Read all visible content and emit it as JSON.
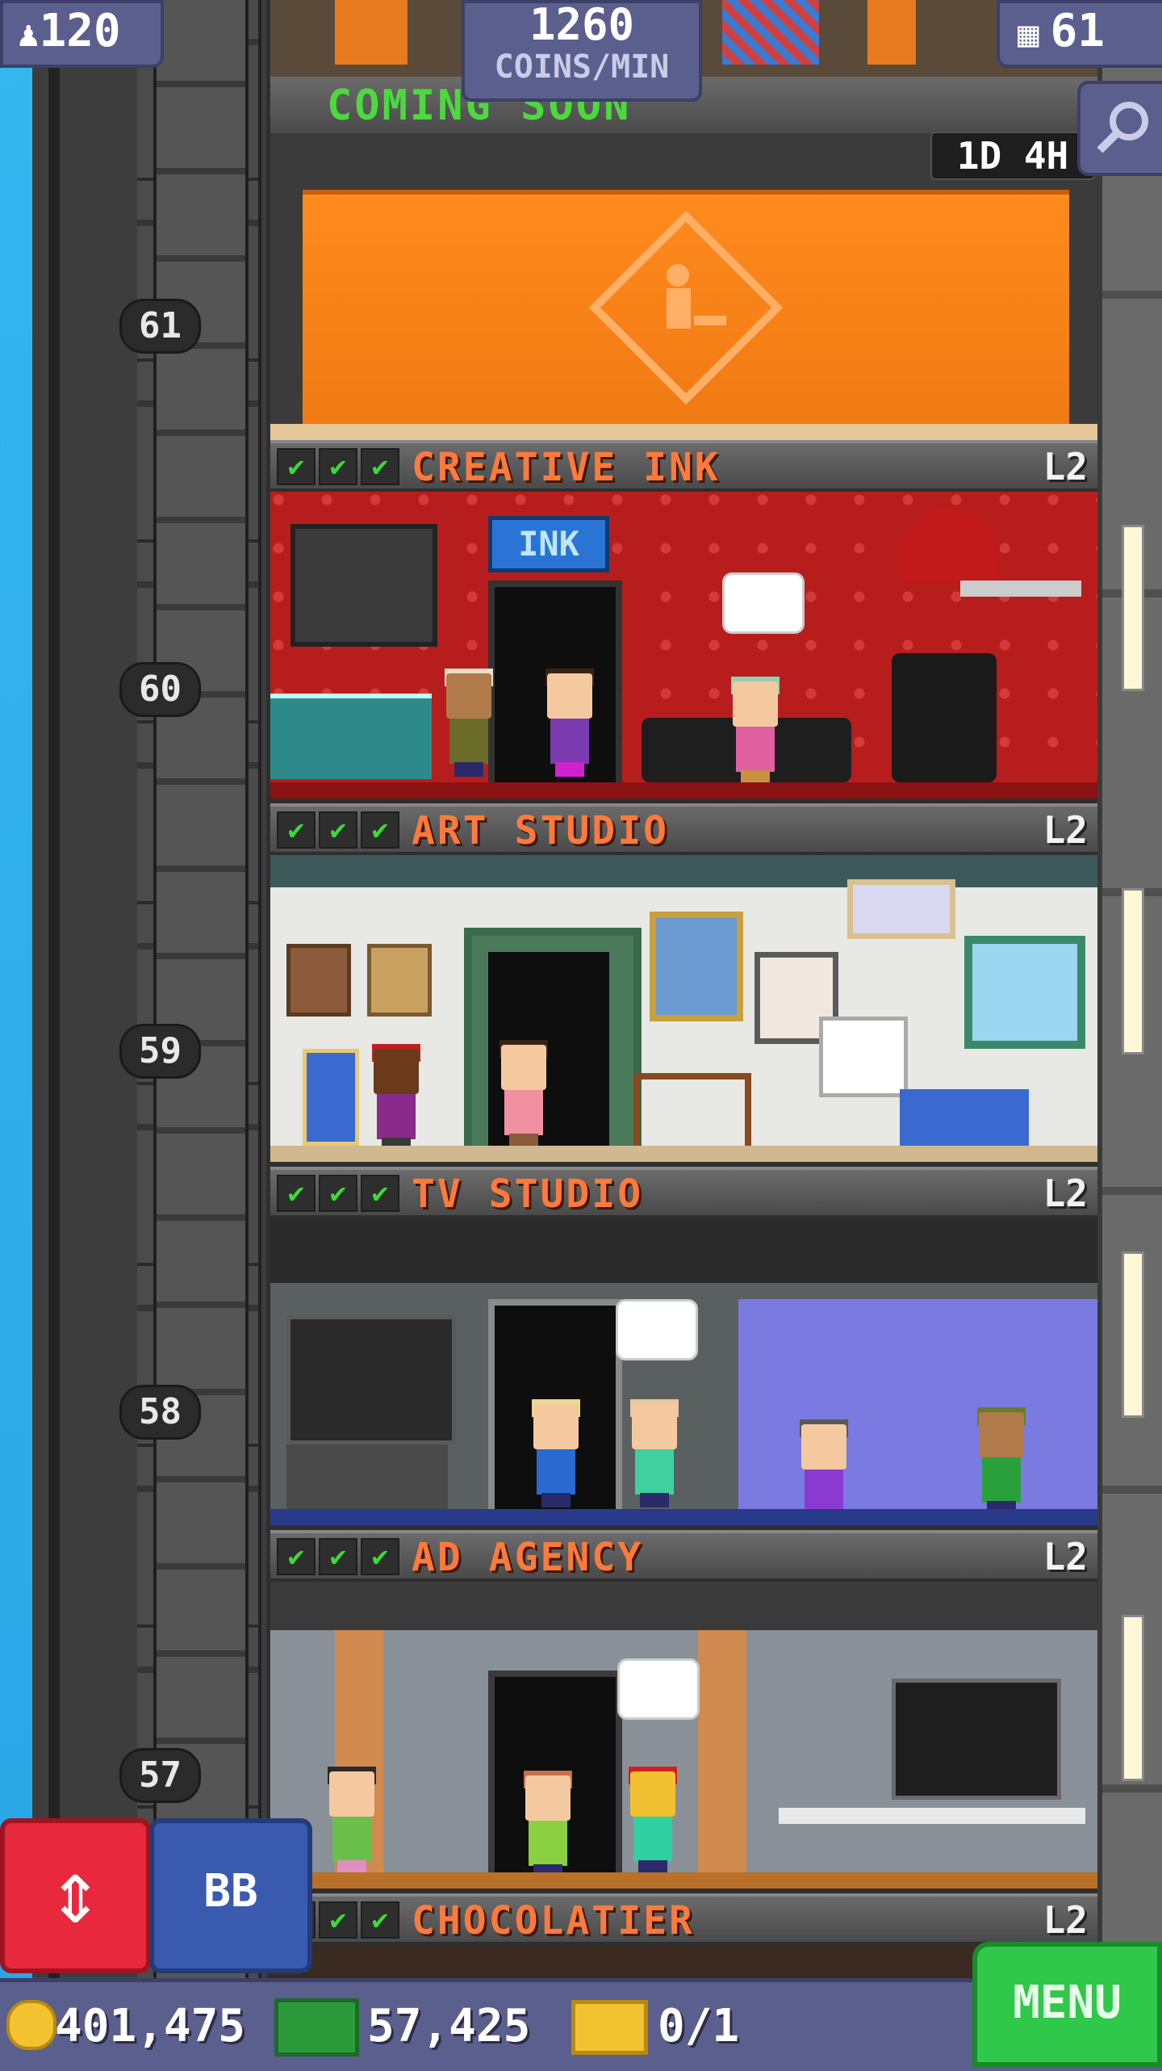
{
  "hud": {
    "residents": "120",
    "coins_rate": "1260",
    "coins_rate_label": "COINS/MIN",
    "floors": "61",
    "timer": "1D 4H"
  },
  "construction": {
    "label": "COMING SOON"
  },
  "floor_numbers": [
    "61",
    "60",
    "59",
    "58",
    "57"
  ],
  "floors": [
    {
      "name": "CREATIVE INK",
      "level": "L2",
      "checks": [
        "✔",
        "✔",
        "✔"
      ],
      "sign": "INK"
    },
    {
      "name": "ART STUDIO",
      "level": "L2",
      "checks": [
        "✔",
        "✔",
        "✔"
      ]
    },
    {
      "name": "TV STUDIO",
      "level": "L2",
      "checks": [
        "✔",
        "✔",
        "✔"
      ]
    },
    {
      "name": "AD AGENCY",
      "level": "L2",
      "checks": [
        "✔",
        "✔",
        "✔"
      ]
    },
    {
      "name": "CHOCOLATIER",
      "level": "L2",
      "checks": [
        "✔",
        "✔",
        "✔"
      ]
    }
  ],
  "buttons": {
    "elevator": "⇕",
    "bitbook": "BB",
    "menu": "MENU"
  },
  "bottom": {
    "coins": "401,475",
    "bux": "57,425",
    "tickets": "0/1"
  },
  "colors": {
    "accent_orange": "#ff7a3a",
    "menu_green": "#2fc84a",
    "hud_blue": "#5a5f8d"
  }
}
